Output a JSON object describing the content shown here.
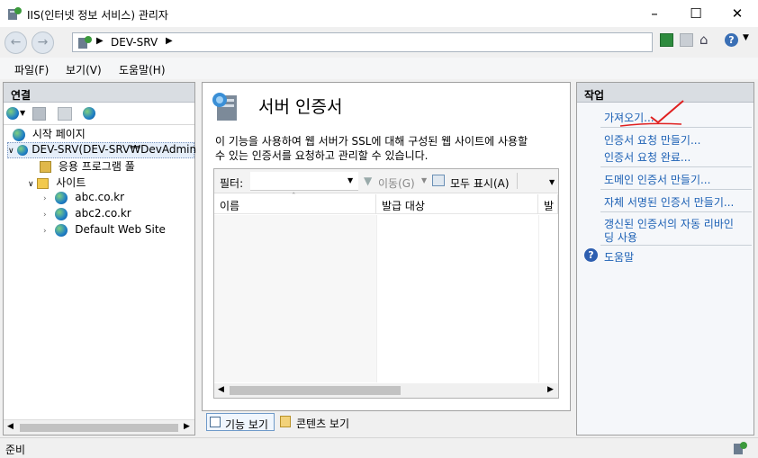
{
  "window": {
    "title": "IIS(인터넷 정보 서비스) 관리자"
  },
  "address": {
    "crumb": "DEV-SRV"
  },
  "menu": [
    "파일(F)",
    "보기(V)",
    "도움말(H)"
  ],
  "connections": {
    "title": "연결",
    "tree": {
      "start": "시작 페이지",
      "server": "DEV-SRV(DEV-SRV₩DevAdmin",
      "app_pools": "응용 프로그램 풀",
      "sites": "사이트",
      "site_items": [
        "abc.co.kr",
        "abc2.co.kr",
        "Default Web Site"
      ]
    }
  },
  "main": {
    "title": "서버 인증서",
    "description_line1": "이 기능을 사용하여 웹 서버가 SSL에 대해 구성된 웹 사이트에 사용할",
    "description_line2": "수 있는 인증서를 요청하고 관리할 수 있습니다.",
    "filter_label": "필터:",
    "go_label": "이동(G)",
    "show_all_label": "모두 표시(A)",
    "columns": [
      "이름",
      "발급 대상",
      "발급"
    ],
    "bottom_tabs": [
      "기능 보기",
      "콘텐츠 보기"
    ]
  },
  "actions": {
    "title": "작업",
    "items": [
      "가져오기...",
      "인증서 요청 만들기...",
      "인증서 요청 완료...",
      "도메인 인증서 만들기...",
      "자체 서명된 인증서 만들기..."
    ],
    "auto_renew_line1": "갱신된 인증서의 자동 리바인",
    "auto_renew_line2": "딩 사용",
    "help": "도움말"
  },
  "status": {
    "text": "준비"
  }
}
